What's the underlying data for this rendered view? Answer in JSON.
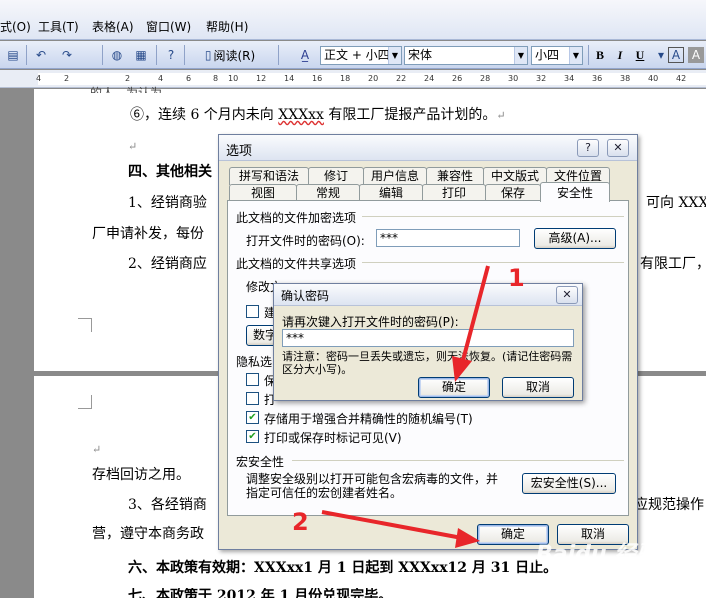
{
  "menu": {
    "items": [
      "式(O)",
      "工具(T)",
      "表格(A)",
      "窗口(W)",
      "帮助(H)"
    ]
  },
  "toolbar": {
    "read_label": "阅读(R)",
    "style_value": "正文 + 小四",
    "font_value": "宋体",
    "size_value": "小四",
    "bold_label": "B",
    "italic_label": "I",
    "underline_label": "U"
  },
  "ruler": {
    "ticks": [
      "4",
      "2",
      "2",
      "4",
      "6",
      "8",
      "10",
      "12",
      "14",
      "16",
      "18",
      "20",
      "22",
      "24",
      "26",
      "28",
      "30",
      "32",
      "34",
      "36",
      "38",
      "40",
      "42"
    ]
  },
  "document": {
    "top_partial": "的人，为认为…",
    "line1": "⑥，连续 6 个月内未向 ",
    "line1_wavy": "XXXxx",
    "line1_end": " 有限工厂提报产品计划的。",
    "heading4": "四、其他相关",
    "line_1_start": "1、经销商验",
    "line_1_right": "可向 XXX",
    "line_factory": "厂申请补发，每份",
    "line_2_start": "2、经销商应",
    "line_2_right": "有限工厂，",
    "archive": "存档回访之用。",
    "line_3_start": "3、各经销商",
    "line_3_right": "应规范操作",
    "line_ying": "营，遵守本商务政",
    "line_6": "六、本政策有效期：XXXxx1 月 1 日起到 XXXxx12 月 31 日止。",
    "line_7": "七、本政策于 2012 年 1 月份兑现完毕。",
    "para_mark": "↵"
  },
  "options_dialog": {
    "title": "选项",
    "help_btn": "?",
    "close_btn": "✕",
    "tabs_row1": [
      "拼写和语法",
      "修订",
      "用户信息",
      "兼容性",
      "中文版式",
      "文件位置"
    ],
    "tabs_row2": [
      "视图",
      "常规",
      "编辑",
      "打印",
      "保存",
      "安全性"
    ],
    "active_tab": "安全性",
    "encrypt_group": "此文档的文件加密选项",
    "open_password_label": "打开文件时的密码(O):",
    "open_password_value": "***",
    "advanced_btn": "高级(A)...",
    "share_group": "此文档的文件共享选项",
    "modify_label": "修改文",
    "build_label": "建",
    "digital_btn": "数字",
    "privacy_group": "隐私选",
    "privacy_chk1": "保",
    "privacy_chk2": "打",
    "random_label": "存储用于增强合并精确性的随机编号(T)",
    "markup_label": "打印或保存时标记可见(V)",
    "macro_group": "宏安全性",
    "macro_desc": "调整安全级别以打开可能包含宏病毒的文件，并指定可信任的宏创建者姓名。",
    "macro_btn": "宏安全性(S)...",
    "ok_btn": "确定",
    "cancel_btn": "取消"
  },
  "confirm_dialog": {
    "title": "确认密码",
    "close_btn": "✕",
    "prompt": "请再次键入打开文件时的密码(P):",
    "value": "***",
    "note": "请注意：密码一旦丢失或遗忘，则无法恢复。(请记住密码需区分大小写)。",
    "ok_btn": "确定",
    "cancel_btn": "取消"
  },
  "annotations": {
    "num1": "1",
    "num2": "2",
    "watermark": "Baidu 经验",
    "arrow_color": "#e8262a"
  }
}
